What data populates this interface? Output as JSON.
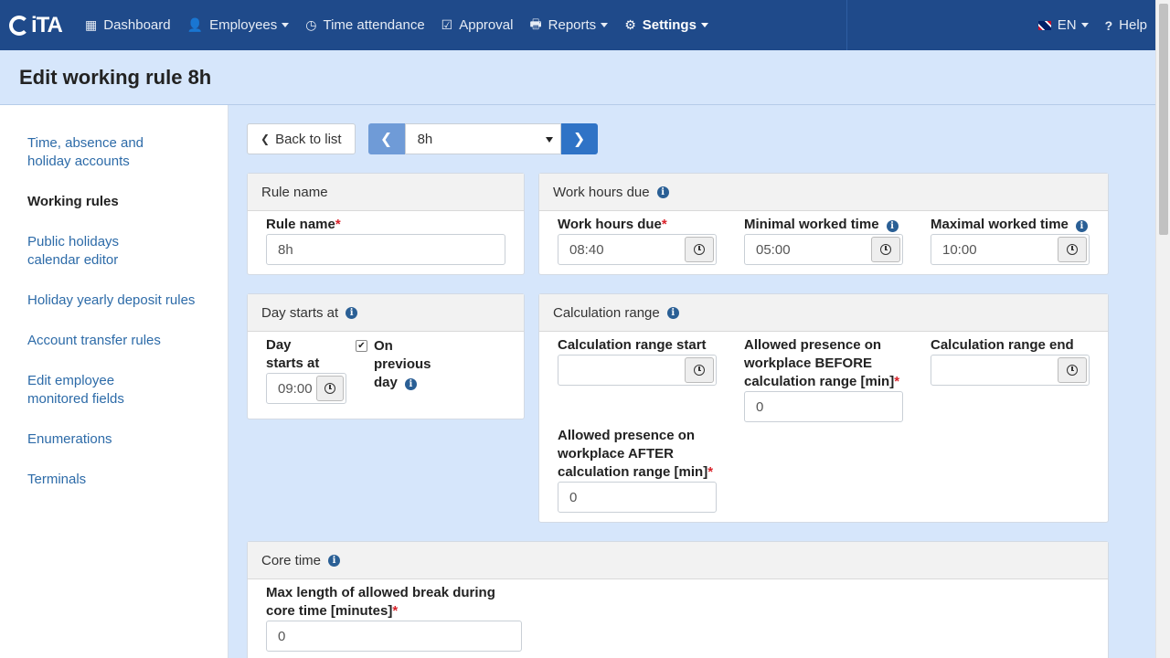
{
  "nav": {
    "brand": "iTA",
    "items": [
      {
        "label": "Dashboard",
        "icon": "grid-icon"
      },
      {
        "label": "Employees",
        "icon": "user-icon"
      },
      {
        "label": "Time attendance",
        "icon": "clock-icon"
      },
      {
        "label": "Approval",
        "icon": "check-icon"
      },
      {
        "label": "Reports",
        "icon": "print-icon"
      },
      {
        "label": "Settings",
        "icon": "gear-icon"
      }
    ],
    "language": "EN",
    "help": "Help"
  },
  "header": {
    "title": "Edit working rule 8h"
  },
  "sidebar": {
    "items": [
      {
        "label": "Time, absence and holiday accounts"
      },
      {
        "label": "Working rules"
      },
      {
        "label": "Public holidays calendar editor"
      },
      {
        "label": "Holiday yearly deposit rules"
      },
      {
        "label": "Account transfer rules"
      },
      {
        "label": "Edit employee monitored fields"
      },
      {
        "label": "Enumerations"
      },
      {
        "label": "Terminals"
      }
    ]
  },
  "toolbar": {
    "back_label": "Back to list",
    "selected_rule": "8h"
  },
  "rule_name": {
    "panel_title": "Rule name",
    "label": "Rule name",
    "value": "8h"
  },
  "work_hours": {
    "panel_title": "Work hours due",
    "due_label": "Work hours due",
    "due_value": "08:40",
    "min_label": "Minimal worked time",
    "min_value": "05:00",
    "max_label": "Maximal worked time",
    "max_value": "10:00"
  },
  "day_start": {
    "panel_title": "Day starts at",
    "label_line1": "Day",
    "label_line2": "starts at",
    "value": "09:00",
    "prev_line1": "On",
    "prev_line2": "previous",
    "prev_line3": "day",
    "prev_checked": true
  },
  "calc_range": {
    "panel_title": "Calculation range",
    "start_label": "Calculation range start",
    "start_value": "",
    "before_line1": "Allowed presence on",
    "before_line2": "workplace BEFORE",
    "before_line3": "calculation range [min]",
    "before_value": "0",
    "end_label": "Calculation range end",
    "end_value": "",
    "after_line1": "Allowed presence on",
    "after_line2": "workplace AFTER",
    "after_line3": "calculation range [min]",
    "after_value": "0"
  },
  "core_time": {
    "panel_title": "Core time",
    "break_line1": "Max length of allowed break during",
    "break_line2": "core time [minutes]",
    "break_value": "0"
  },
  "required_mark": "*"
}
